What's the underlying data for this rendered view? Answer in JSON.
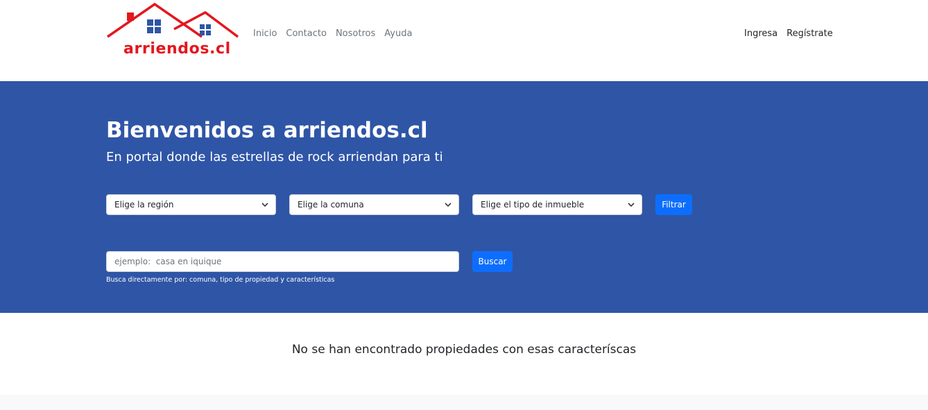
{
  "brand": {
    "name": "arriendos.cl",
    "primary_color": "#e4161e",
    "window_color": "#2f55a6"
  },
  "nav": {
    "links": [
      "Inicio",
      "Contacto",
      "Nosotros",
      "Ayuda"
    ],
    "login": "Ingresa",
    "register": "Regístrate"
  },
  "hero": {
    "title": "Bienvenidos a arriendos.cl",
    "subtitle": "En portal donde las estrellas de rock arriendan para ti",
    "background": "#2f55a6"
  },
  "filters": {
    "region": "Elige la región",
    "comuna": "Elige la comuna",
    "tipo": "Elige el tipo de inmueble",
    "button": "Filtrar"
  },
  "search": {
    "placeholder": "ejemplo:  casa en iquique",
    "value": "",
    "button": "Buscar",
    "help": "Busca directamente por: comuna, tipo de propiedad y características"
  },
  "results": {
    "empty_message": "No se han encontrado propiedades con esas caracteríscas"
  },
  "icons": {
    "dropdown": "chevron-down-icon"
  },
  "colors": {
    "button": "#0d6efd",
    "footer": "#f8f9fa"
  }
}
